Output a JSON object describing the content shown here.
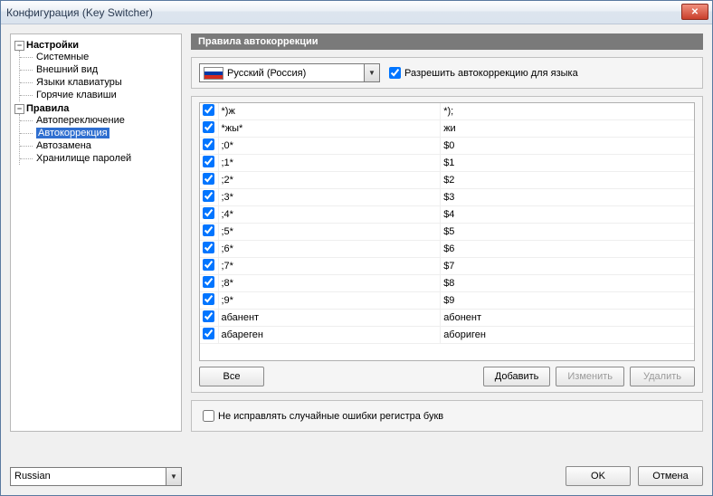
{
  "window": {
    "title": "Конфигурация (Key Switcher)"
  },
  "tree": {
    "group1": {
      "label": "Настройки",
      "items": [
        "Системные",
        "Внешний вид",
        "Языки клавиатуры",
        "Горячие клавиши"
      ]
    },
    "group2": {
      "label": "Правила",
      "items": [
        "Автопереключение",
        "Автокоррекция",
        "Автозамена",
        "Хранилище паролей"
      ],
      "selectedIndex": 1
    }
  },
  "section_title": "Правила автокоррекции",
  "language": {
    "combo_text": "Русский (Россия)",
    "allow_label": "Разрешить автокоррекцию для языка",
    "allow_checked": true
  },
  "rules": [
    {
      "on": true,
      "from": "*)ж",
      "to": "*);"
    },
    {
      "on": true,
      "from": "*жы*",
      "to": "жи"
    },
    {
      "on": true,
      "from": ";0*",
      "to": "$0"
    },
    {
      "on": true,
      "from": ";1*",
      "to": "$1"
    },
    {
      "on": true,
      "from": ";2*",
      "to": "$2"
    },
    {
      "on": true,
      "from": ";3*",
      "to": "$3"
    },
    {
      "on": true,
      "from": ";4*",
      "to": "$4"
    },
    {
      "on": true,
      "from": ";5*",
      "to": "$5"
    },
    {
      "on": true,
      "from": ";6*",
      "to": "$6"
    },
    {
      "on": true,
      "from": ";7*",
      "to": "$7"
    },
    {
      "on": true,
      "from": ";8*",
      "to": "$8"
    },
    {
      "on": true,
      "from": ";9*",
      "to": "$9"
    },
    {
      "on": true,
      "from": "абанент",
      "to": "абонент"
    },
    {
      "on": true,
      "from": "абареген",
      "to": "абориген"
    }
  ],
  "buttons": {
    "all": "Все",
    "add": "Добавить",
    "edit": "Изменить",
    "del": "Удалить",
    "ok": "OK",
    "cancel": "Отмена"
  },
  "case_fix": {
    "label": "Не исправлять случайные ошибки регистра букв",
    "checked": false
  },
  "bottom_lang": "Russian"
}
